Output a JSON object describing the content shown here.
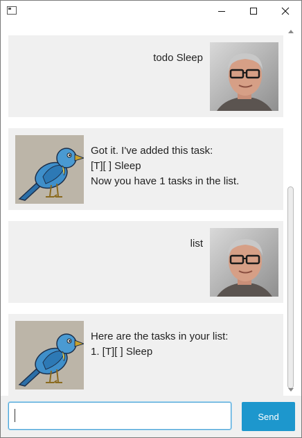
{
  "window": {
    "controls": [
      "minimize-icon",
      "maximize-icon",
      "close-icon"
    ]
  },
  "dialogs": [
    {
      "speaker": "user",
      "lines": [
        "todo Sleep"
      ]
    },
    {
      "speaker": "duke",
      "lines": [
        "Got it. I've added this task:",
        "[T][ ] Sleep",
        "Now you have 1 tasks in the list."
      ]
    },
    {
      "speaker": "user",
      "lines": [
        "list"
      ]
    },
    {
      "speaker": "duke",
      "lines": [
        "Here are the tasks in your list:",
        "1. [T][ ] Sleep"
      ]
    }
  ],
  "input": {
    "value": "",
    "placeholder": ""
  },
  "send_button": {
    "label": "Send"
  },
  "colors": {
    "accent": "#1d97cd",
    "dialog_background": "#f0f0f0",
    "input_focus_border": "#4fa5d6"
  }
}
